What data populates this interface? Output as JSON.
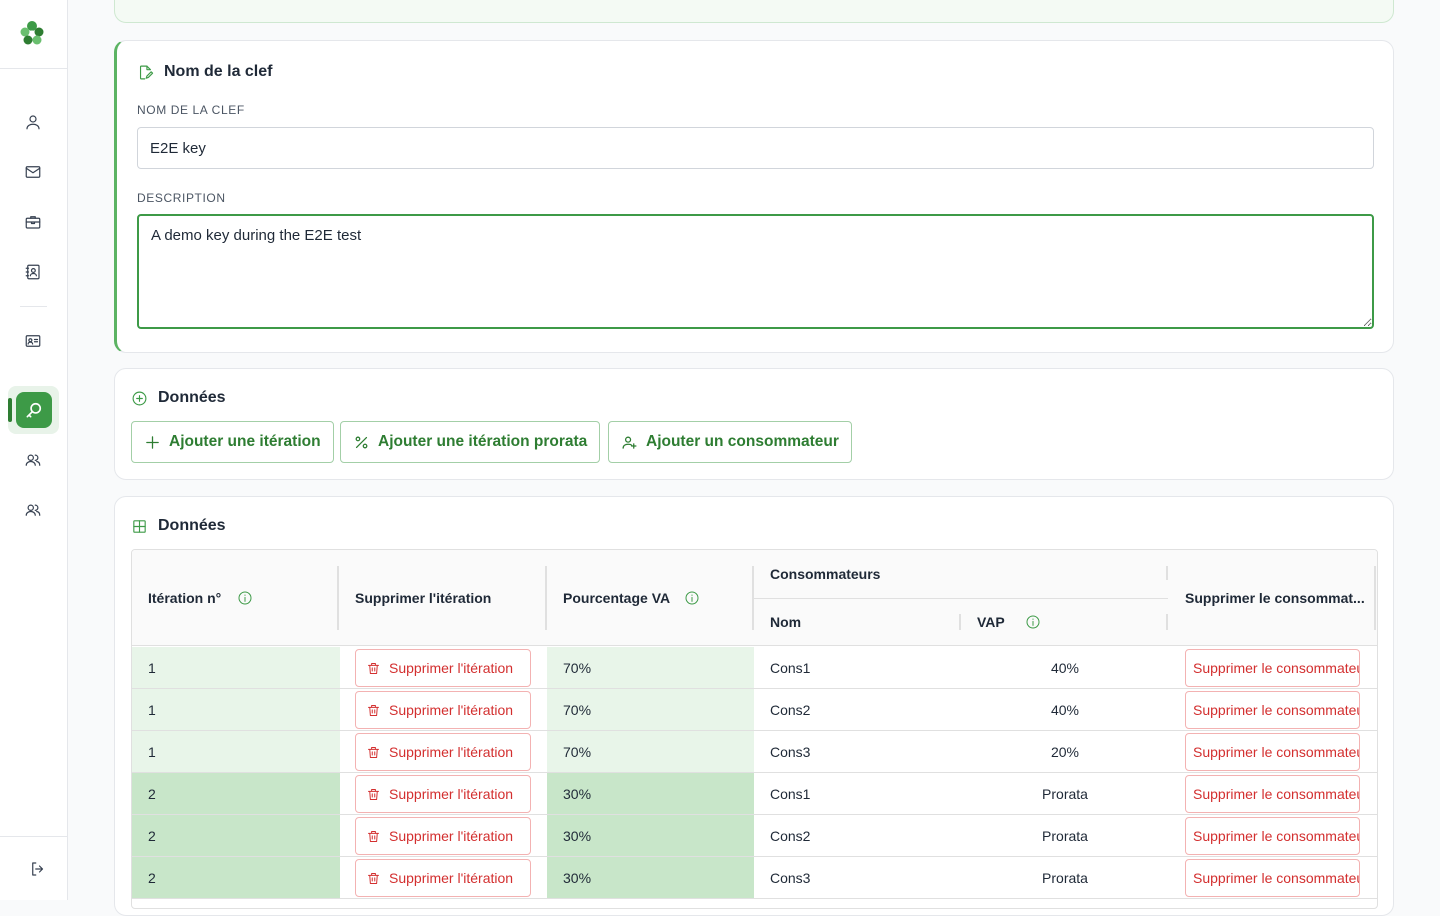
{
  "sidebar": {
    "nav_icons": [
      "user-icon",
      "mail-icon",
      "briefcase-icon",
      "contact-book-icon",
      "id-card-icon",
      "key-search-icon",
      "users-icon",
      "team-icon"
    ],
    "active": "key-search-icon",
    "logout_icon": "logout-icon"
  },
  "key_card": {
    "title": "Nom de la clef",
    "name_label": "NOM DE LA CLEF",
    "name_value": "E2E key",
    "description_label": "DESCRIPTION",
    "description_value": "A demo key during the E2E test"
  },
  "actions_card": {
    "title": "Données",
    "add_iteration": "Ajouter une itération",
    "add_prorata_iteration": "Ajouter une itération prorata",
    "add_consumer": "Ajouter un consommateur"
  },
  "table_card": {
    "title": "Données",
    "headers": {
      "iteration": "Itération n°",
      "delete_iteration": "Supprimer l'itération",
      "percentage": "Pourcentage VA",
      "consumers": "Consommateurs",
      "name": "Nom",
      "vap": "VAP",
      "delete_consumer": "Supprimer le consommat..."
    },
    "delete_iteration_label": "Supprimer l'itération",
    "delete_consumer_label": "Supprimer le consommateur",
    "rows": [
      {
        "iteration": "1",
        "percentage": "70%",
        "name": "Cons1",
        "vap": "40%"
      },
      {
        "iteration": "1",
        "percentage": "70%",
        "name": "Cons2",
        "vap": "40%"
      },
      {
        "iteration": "1",
        "percentage": "70%",
        "name": "Cons3",
        "vap": "20%"
      },
      {
        "iteration": "2",
        "percentage": "30%",
        "name": "Cons1",
        "vap": "Prorata"
      },
      {
        "iteration": "2",
        "percentage": "30%",
        "name": "Cons2",
        "vap": "Prorata"
      },
      {
        "iteration": "2",
        "percentage": "30%",
        "name": "Cons3",
        "vap": "Prorata"
      }
    ]
  },
  "colors": {
    "accent": "#3d9a47",
    "accent_dark": "#2e7d32",
    "iteration_1_bg": "#e8f5e9",
    "iteration_2_bg": "#c8e6c9",
    "danger": "#d32f2f"
  }
}
